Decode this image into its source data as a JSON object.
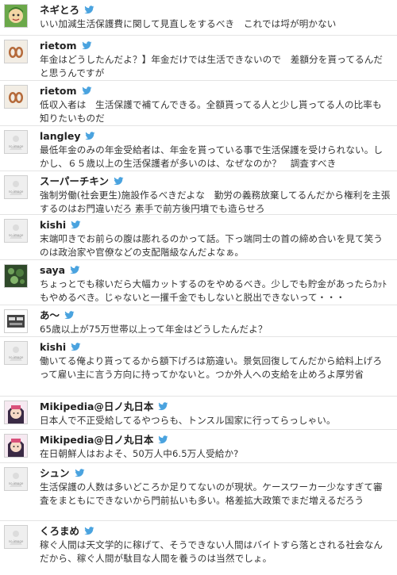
{
  "colors": {
    "bird": "#4aa3df",
    "divider": "#e4e4e4",
    "text": "#333333"
  },
  "tweets": [
    {
      "name": "ネギとろ",
      "avatar": "face-icon",
      "text": "いい加減生活保護費に関して見直しをするべき　これでは埒が明かない"
    },
    {
      "name": "rietom",
      "avatar": "rietom-avatar-icon",
      "text": "年金はどうしたんだよ？】年金だけでは生活できないので　差額分を貰ってるんだと思うんですが"
    },
    {
      "name": "rietom",
      "avatar": "rietom-avatar-icon",
      "text": "低収入者は　生活保護で補てんできる。全額貰ってる人と少し貰ってる人の比率も知りたいものだ"
    },
    {
      "name": "langley",
      "avatar": "no-image",
      "text": "最低年金のみの年金受給者は、年金を貰っている事で生活保護を受けられない。しかし、６５歳以上の生活保護者が多いのは、なぜなのか？　調査すべき"
    },
    {
      "name": "スーパーチキン",
      "avatar": "no-image",
      "text": "強制労働(社会更生)施設作るべきだよな　勤労の義務放棄してるんだから権利を主張するのはお門違いだろ 素手で前方後円墳でも造らせろ"
    },
    {
      "name": "kishi",
      "avatar": "no-image",
      "text": "末端叩きでお前らの腹は膨れるのかって話。下っ端同士の首の締め合いを見て笑うのは政治家や官僚などの支配階級なんだよなぁ。"
    },
    {
      "name": "saya",
      "avatar": "saya-avatar-icon",
      "text": "ちょっとでも稼いだら大幅カットするのをやめるべき。少しでも貯金があったらｶｯﾄもやめるべき。じゃないと一攫千金でもしないと脱出できないって・・・"
    },
    {
      "name": "あ〜",
      "avatar": "a-avatar-icon",
      "text": "65歳以上が75万世帯以上って年金はどうしたんだよ？"
    },
    {
      "name": "kishi",
      "avatar": "no-image",
      "text": "働いてる俺より貰ってるから額下げろは筋違い。景気回復してんだから給料上げろって雇い主に言う方向に持ってかないと。つか外人への支給を止めろよ厚労省"
    },
    {
      "name": "Mikipedia@日ノ丸日本",
      "avatar": "mikipedia-avatar-icon",
      "text": "日本人で不正受給してるやつらも、トンスル国家に行ってらっしゃい。"
    },
    {
      "name": "Mikipedia@日ノ丸日本",
      "avatar": "mikipedia-avatar-icon",
      "text": "在日朝鮮人はおよそ、50万人中6.5万人受給か?"
    },
    {
      "name": "シュン",
      "avatar": "no-image",
      "text": "生活保護の人数は多いどころか足りてないのが現状。ケースワーカー少なすぎて審査をまともにできないから門前払いも多い。格差拡大政策でまだ増えるだろう"
    },
    {
      "name": "くろまめ",
      "avatar": "no-image",
      "text": "稼ぐ人間は天文学的に稼げて、そうできない人間はバイトすら落とされる社会なんだから、稼ぐ人間が駄目な人間を養うのは当然でしょ。"
    }
  ],
  "no_image_label": "no image"
}
